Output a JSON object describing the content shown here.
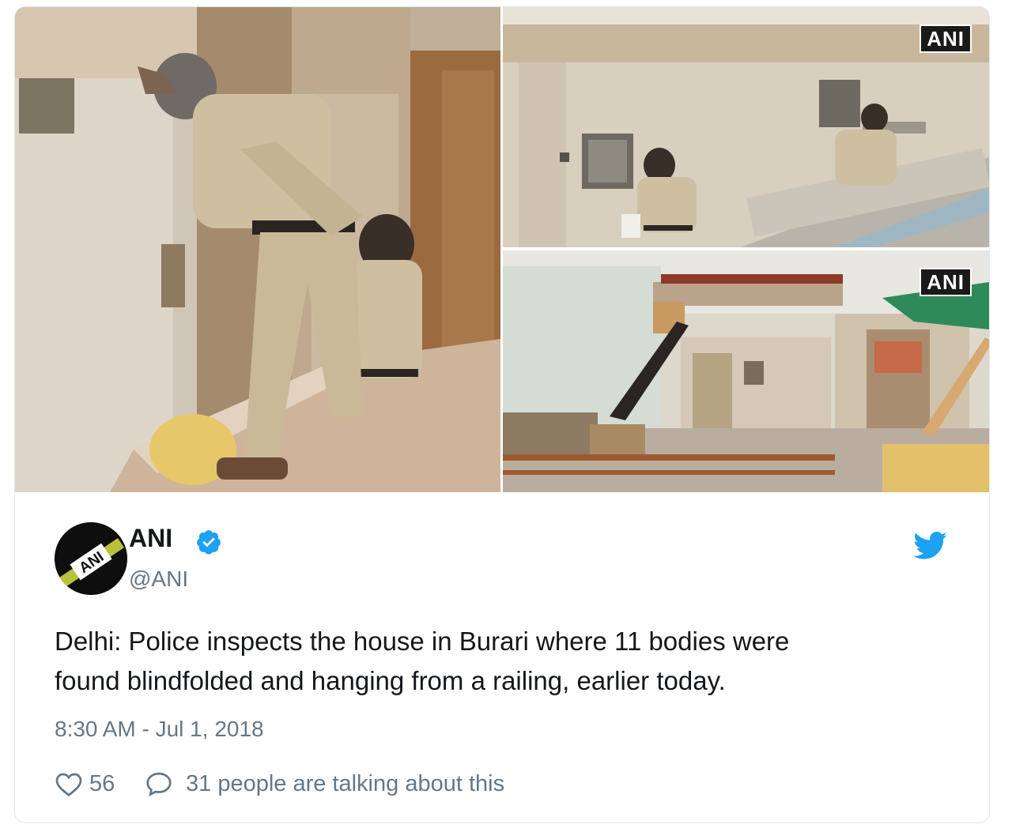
{
  "media": {
    "watermark_top_right": "ANI",
    "watermark_bottom_right": "ANI"
  },
  "author": {
    "name": "ANI",
    "handle": "@ANI",
    "avatar_text": "ANI",
    "verified": true
  },
  "tweet": {
    "text_line1": "Delhi: Police inspects the house in Burari where 11 bodies were",
    "text_line2": "found blindfolded and hanging from a railing, earlier today.",
    "timestamp": "8:30 AM - Jul 1, 2018"
  },
  "actions": {
    "likes": "56",
    "talking": "31 people are talking about this"
  },
  "colors": {
    "twitter_blue": "#1da1f2",
    "muted": "#657786",
    "text": "#14171a"
  }
}
